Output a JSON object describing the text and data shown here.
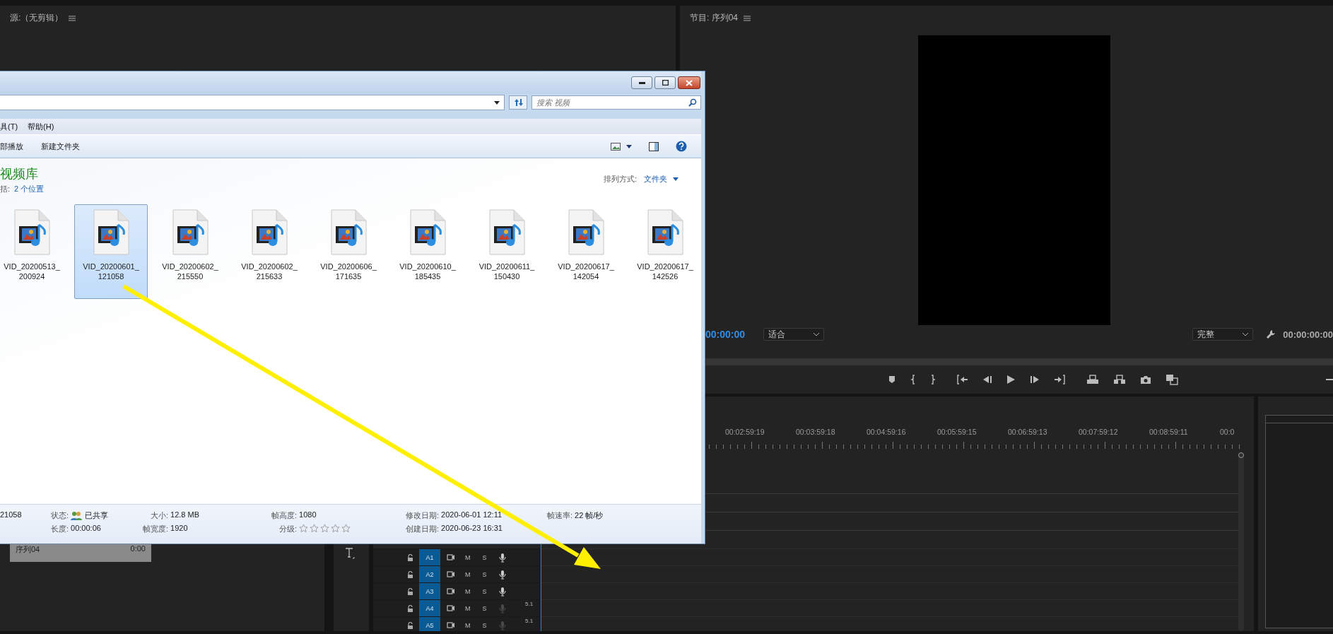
{
  "source_panel": {
    "title": "源:（无剪辑）"
  },
  "program_panel": {
    "title": "节目: 序列04",
    "timecode": "00:00:00",
    "zoom_select": "适合",
    "quality_select": "完整",
    "duration": "00:00:00:00"
  },
  "project_panel": {
    "items": [
      {
        "name": "序列04",
        "duration": "0:00",
        "selected": true
      }
    ]
  },
  "timeline": {
    "ruler": [
      "00:02:59:19",
      "00:03:59:18",
      "00:04:59:16",
      "00:05:59:15",
      "00:06:59:13",
      "00:07:59:12",
      "00:08:59:11",
      "00:0"
    ],
    "audio_tracks": [
      {
        "name": "A1",
        "mute": "M",
        "solo": "S",
        "mic_enabled": true
      },
      {
        "name": "A2",
        "mute": "M",
        "solo": "S",
        "mic_enabled": true
      },
      {
        "name": "A3",
        "mute": "M",
        "solo": "S",
        "mic_enabled": true
      },
      {
        "name": "A4",
        "mute": "M",
        "solo": "S",
        "mic_enabled": false,
        "channels": "5.1"
      },
      {
        "name": "A5",
        "mute": "M",
        "solo": "S",
        "mic_enabled": false,
        "channels": "5.1"
      }
    ]
  },
  "explorer": {
    "menu": [
      "具(T)",
      "帮助(H)"
    ],
    "toolbar": [
      "部播放",
      "新建文件夹"
    ],
    "search": {
      "placeholder": "搜索 视频"
    },
    "library": {
      "title": "视频库",
      "includes_label": "括:",
      "includes_link": "2 个位置",
      "arrange_label": "排列方式:",
      "arrange_value": "文件夹"
    },
    "files": [
      {
        "name": "VID_20200513_200924",
        "selected": false
      },
      {
        "name": "VID_20200601_121058",
        "selected": true
      },
      {
        "name": "VID_20200602_215550",
        "selected": false
      },
      {
        "name": "VID_20200602_215633",
        "selected": false
      },
      {
        "name": "VID_20200606_171635",
        "selected": false
      },
      {
        "name": "VID_20200610_185435",
        "selected": false
      },
      {
        "name": "VID_20200611_150430",
        "selected": false
      },
      {
        "name": "VID_20200617_142054",
        "selected": false
      },
      {
        "name": "VID_20200617_142526",
        "selected": false
      }
    ],
    "details": {
      "file_name": "21058",
      "columns": [
        [
          {
            "kind": "shared",
            "label": "状态:",
            "value": "已共享"
          },
          {
            "kind": "text",
            "label": "长度:",
            "value": "00:00:06"
          }
        ],
        [
          {
            "kind": "text",
            "label": "大小:",
            "value": "12.8 MB"
          },
          {
            "kind": "text",
            "label": "帧宽度:",
            "value": "1920"
          }
        ],
        [
          {
            "kind": "text",
            "label": "帧高度:",
            "value": "1080"
          },
          {
            "kind": "rating",
            "label": "分级:",
            "stars": 0
          }
        ],
        [
          {
            "kind": "text",
            "label": "修改日期:",
            "value": "2020-06-01 12:11"
          },
          {
            "kind": "text",
            "label": "创建日期:",
            "value": "2020-06-23 16:31"
          }
        ],
        [
          {
            "kind": "text",
            "label": "帧速率:",
            "value": "22 帧/秒"
          }
        ]
      ]
    }
  }
}
